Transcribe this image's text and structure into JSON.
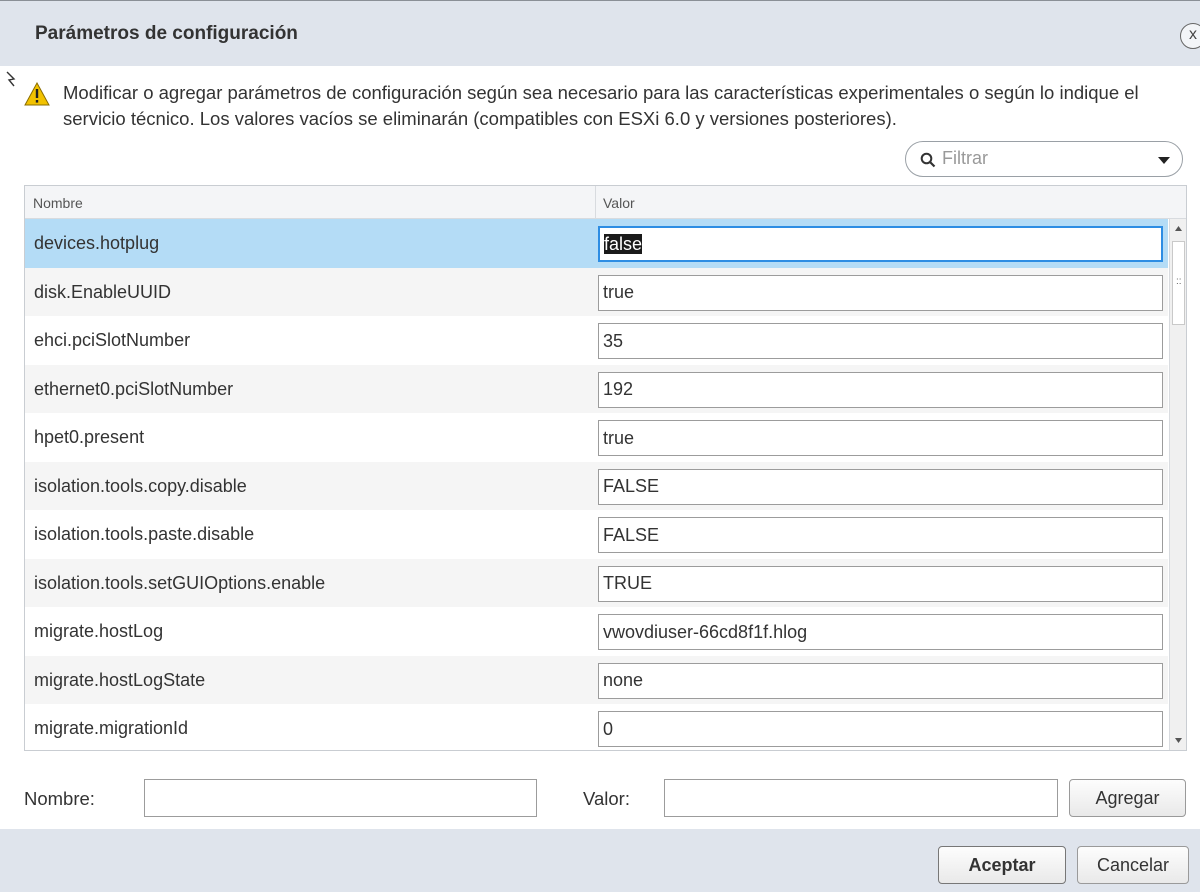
{
  "dialog": {
    "title": "Parámetros de configuración",
    "close_label": "x",
    "warning": "Modificar o agregar parámetros de configuración según sea necesario para las características experimentales o según lo indique el servicio técnico. Los valores vacíos se eliminarán (compatibles con ESXi 6.0 y versiones posteriores).",
    "warning_icon": "warning-triangle-icon"
  },
  "filter": {
    "placeholder": "Filtrar",
    "icon": "search-icon"
  },
  "table": {
    "columns": [
      "Nombre",
      "Valor"
    ],
    "rows": [
      {
        "name": "devices.hotplug",
        "value": "false"
      },
      {
        "name": "disk.EnableUUID",
        "value": "true"
      },
      {
        "name": "ehci.pciSlotNumber",
        "value": "35"
      },
      {
        "name": "ethernet0.pciSlotNumber",
        "value": "192"
      },
      {
        "name": "hpet0.present",
        "value": "true"
      },
      {
        "name": "isolation.tools.copy.disable",
        "value": "FALSE"
      },
      {
        "name": "isolation.tools.paste.disable",
        "value": "FALSE"
      },
      {
        "name": "isolation.tools.setGUIOptions.enable",
        "value": "TRUE"
      },
      {
        "name": "migrate.hostLog",
        "value": "vwovdiuser-66cd8f1f.hlog"
      },
      {
        "name": "migrate.hostLogState",
        "value": "none"
      },
      {
        "name": "migrate.migrationId",
        "value": "0"
      }
    ]
  },
  "add_form": {
    "name_label": "Nombre:",
    "value_label": "Valor:",
    "add_button": "Agregar"
  },
  "footer": {
    "ok_button": "Aceptar",
    "cancel_button": "Cancelar"
  },
  "colors": {
    "header_bg": "#dfe4ec",
    "selected_row": "#b4dcf6",
    "focus_border": "#2d8de3",
    "warning_yellow": "#f2c200"
  }
}
